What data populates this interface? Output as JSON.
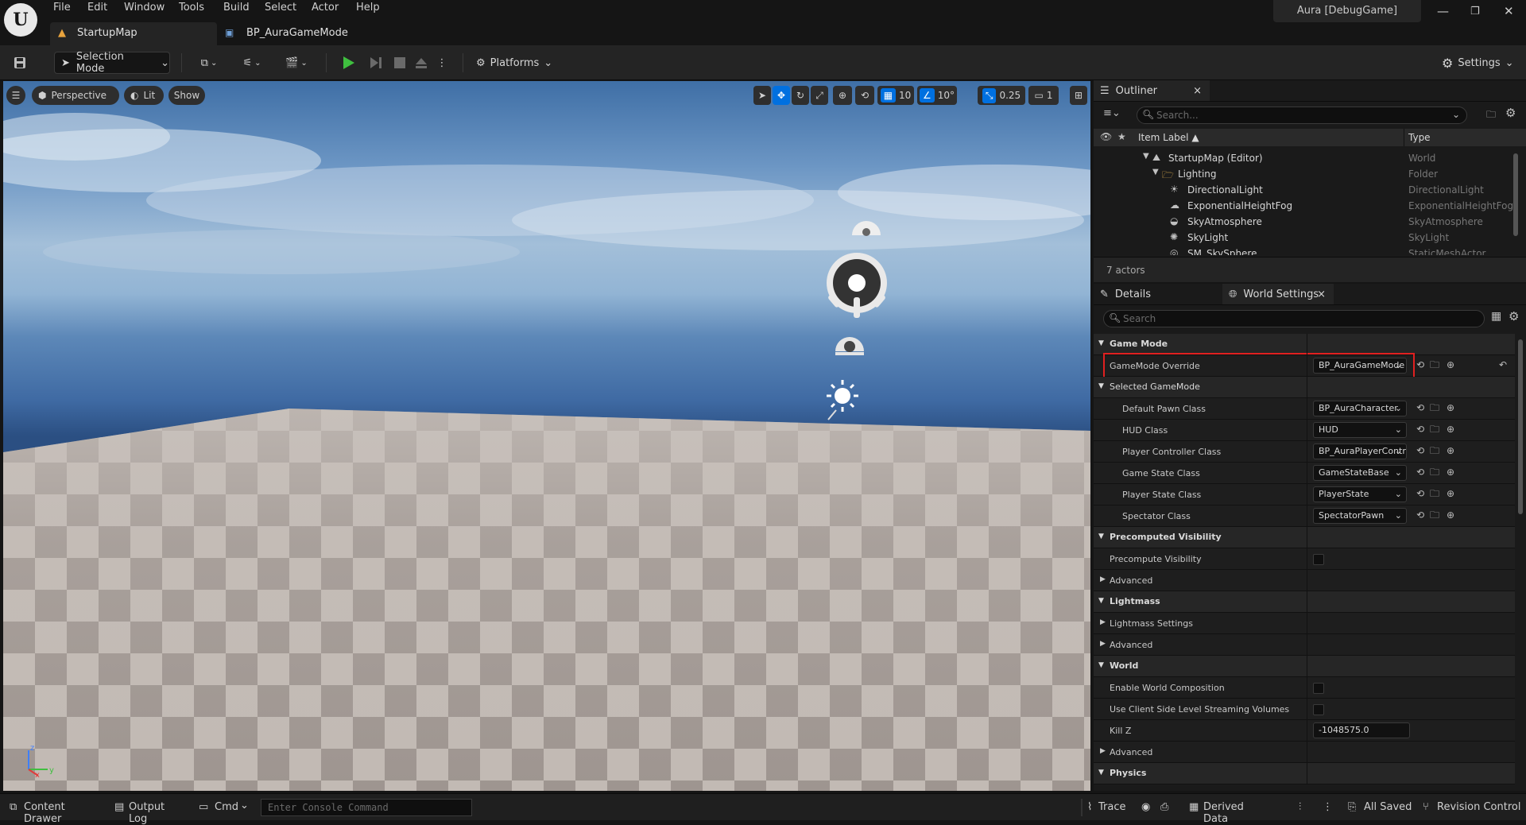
{
  "menu": {
    "items": [
      "File",
      "Edit",
      "Window",
      "Tools",
      "Build",
      "Select",
      "Actor",
      "Help"
    ]
  },
  "tabs": {
    "main": "StartupMap",
    "second": "BP_AuraGameMode"
  },
  "window": {
    "project": "Aura [DebugGame]"
  },
  "toolbar": {
    "mode": "Selection Mode",
    "platforms": "Platforms",
    "settings": "Settings"
  },
  "viewport": {
    "perspective": "Perspective",
    "lit": "Lit",
    "show": "Show",
    "grid_snap": "10",
    "rot_snap": "10°",
    "scale_snap": "0.25",
    "camera_speed": "1"
  },
  "outliner": {
    "title": "Outliner",
    "search_placeholder": "Search...",
    "col_label": "Item Label ▲",
    "col_type": "Type",
    "rows": [
      {
        "label": "StartupMap (Editor)",
        "type": "World"
      },
      {
        "label": "Lighting",
        "type": "Folder"
      },
      {
        "label": "DirectionalLight",
        "type": "DirectionalLight"
      },
      {
        "label": "ExponentialHeightFog",
        "type": "ExponentialHeightFog"
      },
      {
        "label": "SkyAtmosphere",
        "type": "SkyAtmosphere"
      },
      {
        "label": "SkyLight",
        "type": "SkyLight"
      },
      {
        "label": "SM_SkySphere",
        "type": "StaticMeshActor"
      }
    ],
    "actors": "7 actors"
  },
  "details": {
    "tab_details": "Details",
    "tab_world": "World Settings",
    "search_placeholder": "Search",
    "sec_gamemode": "Game Mode",
    "gm_override_label": "GameMode Override",
    "gm_override_value": "BP_AuraGameMode",
    "sec_selected": "Selected GameMode",
    "rows": [
      {
        "label": "Default Pawn Class",
        "value": "BP_AuraCharacter"
      },
      {
        "label": "HUD Class",
        "value": "HUD"
      },
      {
        "label": "Player Controller Class",
        "value": "BP_AuraPlayerController"
      },
      {
        "label": "Game State Class",
        "value": "GameStateBase"
      },
      {
        "label": "Player State Class",
        "value": "PlayerState"
      },
      {
        "label": "Spectator Class",
        "value": "SpectatorPawn"
      }
    ],
    "sec_precompute": "Precomputed Visibility",
    "precompute_vis": "Precompute Visibility",
    "advanced": "Advanced",
    "sec_lightmass": "Lightmass",
    "lightmass_settings": "Lightmass Settings",
    "sec_world": "World",
    "enable_world_comp": "Enable World Composition",
    "client_side": "Use Client Side Level Streaming Volumes",
    "kill_z_label": "Kill Z",
    "kill_z_value": "-1048575.0",
    "sec_physics": "Physics"
  },
  "statusbar": {
    "content_drawer": "Content Drawer",
    "output_log": "Output Log",
    "cmd": "Cmd",
    "console_placeholder": "Enter Console Command",
    "trace": "Trace",
    "derived_data": "Derived Data",
    "all_saved": "All Saved",
    "revision_control": "Revision Control"
  },
  "colors": {
    "accent": "#0070e0",
    "play_green": "#3fbf3f",
    "highlight_red": "#e02020"
  }
}
